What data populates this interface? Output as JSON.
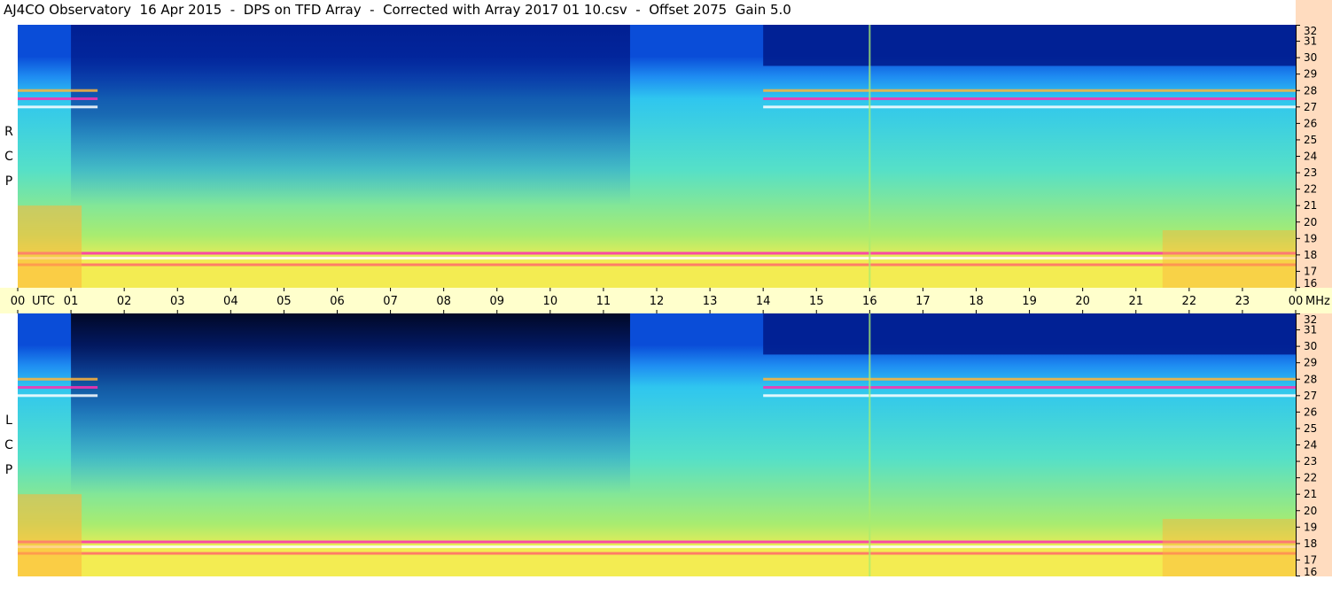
{
  "title": "AJ4CO Observatory  16 Apr 2015  -  DPS on TFD Array  -  Corrected with Array 2017 01 10.csv  -  Offset 2075  Gain 5.0",
  "chart_data": {
    "type": "heatmap",
    "title": "AJ4CO Observatory  16 Apr 2015  -  DPS on TFD Array  -  Corrected with Array 2017 01 10.csv  -  Offset 2075  Gain 5.0",
    "x_axis": {
      "ticks": [
        "00",
        "01",
        "02",
        "03",
        "04",
        "05",
        "06",
        "07",
        "08",
        "09",
        "10",
        "11",
        "12",
        "13",
        "14",
        "15",
        "16",
        "17",
        "18",
        "19",
        "20",
        "21",
        "22",
        "23",
        "00"
      ],
      "first_tick_suffix": "UTC",
      "last_tick_suffix": "MHz",
      "range": [
        0,
        24
      ]
    },
    "y_axis": {
      "ticks": [
        "16",
        "17",
        "18",
        "19",
        "20",
        "21",
        "22",
        "23",
        "24",
        "25",
        "26",
        "27",
        "28",
        "29",
        "30",
        "31",
        "32"
      ],
      "range": [
        16,
        32
      ]
    },
    "panels": [
      {
        "label": [
          "R",
          "C",
          "P"
        ]
      },
      {
        "label": [
          "L",
          "C",
          "P"
        ]
      }
    ],
    "colormap": [
      "#000012",
      "#001a8a",
      "#0a4dd8",
      "#1f8ef2",
      "#2fc6ef",
      "#55e0c8",
      "#a8ec70",
      "#f3ec52",
      "#ffb43a",
      "#ff6a6a",
      "#ff2fb0",
      "#ffffff"
    ]
  }
}
